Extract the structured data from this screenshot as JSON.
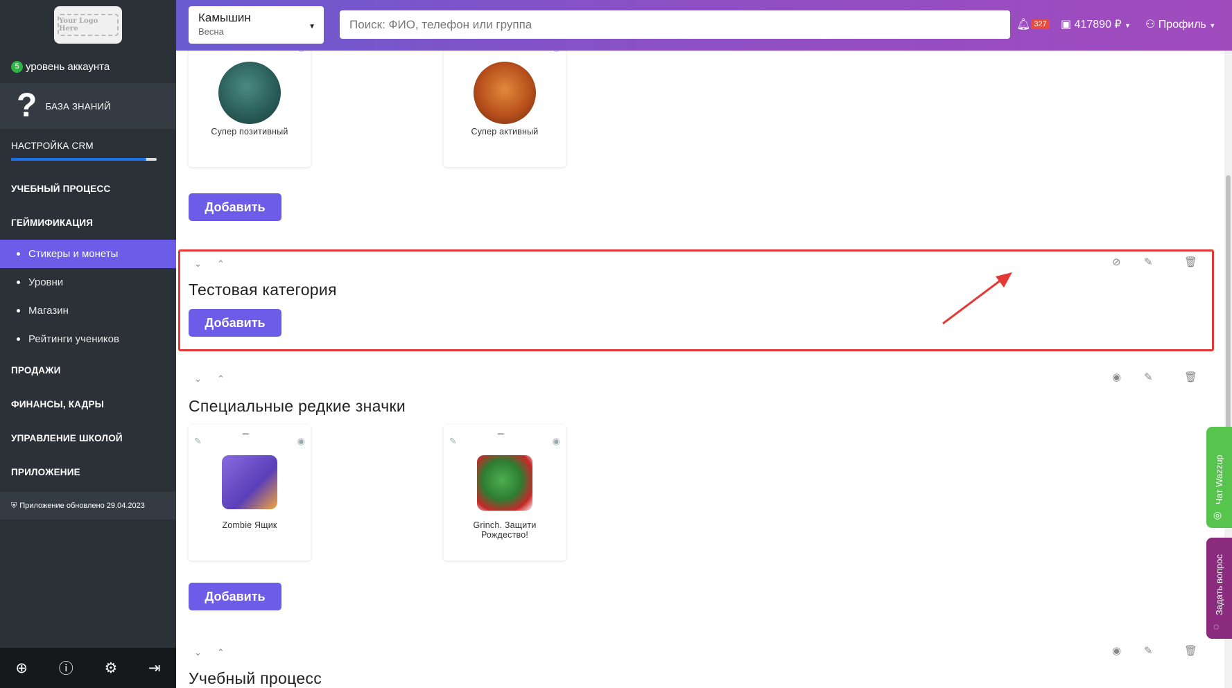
{
  "sidebar": {
    "logo_text": "Your Logo Here",
    "account_level_number": "5",
    "account_level_label": "уровень аккаунта",
    "knowledge_base_label": "БАЗА ЗНАНИЙ",
    "crm_setup_label": "НАСТРОЙКА CRM",
    "crm_setup_progress": 0.93,
    "nav": {
      "learning": "УЧЕБНЫЙ ПРОЦЕСС",
      "gamification": "ГЕЙМИФИКАЦИЯ",
      "sales": "ПРОДАЖИ",
      "finance": "ФИНАНСЫ, КАДРЫ",
      "school": "УПРАВЛЕНИЕ ШКОЛОЙ",
      "app": "ПРИЛОЖЕНИЕ"
    },
    "submenu": [
      "Стикеры и монеты",
      "Уровни",
      "Магазин",
      "Рейтинги учеников"
    ],
    "updated_text": "Приложение обновлено 29.04.2023",
    "footer_icons": [
      "support-icon",
      "help-icon",
      "settings-icon",
      "logout-icon"
    ]
  },
  "header": {
    "branch_name": "Камышин",
    "branch_season": "Весна",
    "search_placeholder": "Поиск: ФИО, телефон или группа",
    "notifications_count": "327",
    "balance": "417890 ₽",
    "profile_label": "Профиль"
  },
  "content": {
    "add_label": "Добавить",
    "cards_top": [
      {
        "label": "Супер позитивный"
      },
      {
        "label": "Супер активный"
      }
    ],
    "test_category_title": "Тестовая категория",
    "rare_category_title": "Специальные редкие значки",
    "cards_rare": [
      {
        "label": "Zombie Ящик"
      },
      {
        "label": "Grinch. Защити Рождество!"
      }
    ],
    "learning_category_title": "Учебный процесс"
  },
  "side_tabs": {
    "wazzup": "Чат Wazzup",
    "ask": "Задать вопрос"
  },
  "colors": {
    "accent": "#6c5ce7",
    "sidebar_bg": "#2b3137",
    "highlight": "#e53935"
  }
}
